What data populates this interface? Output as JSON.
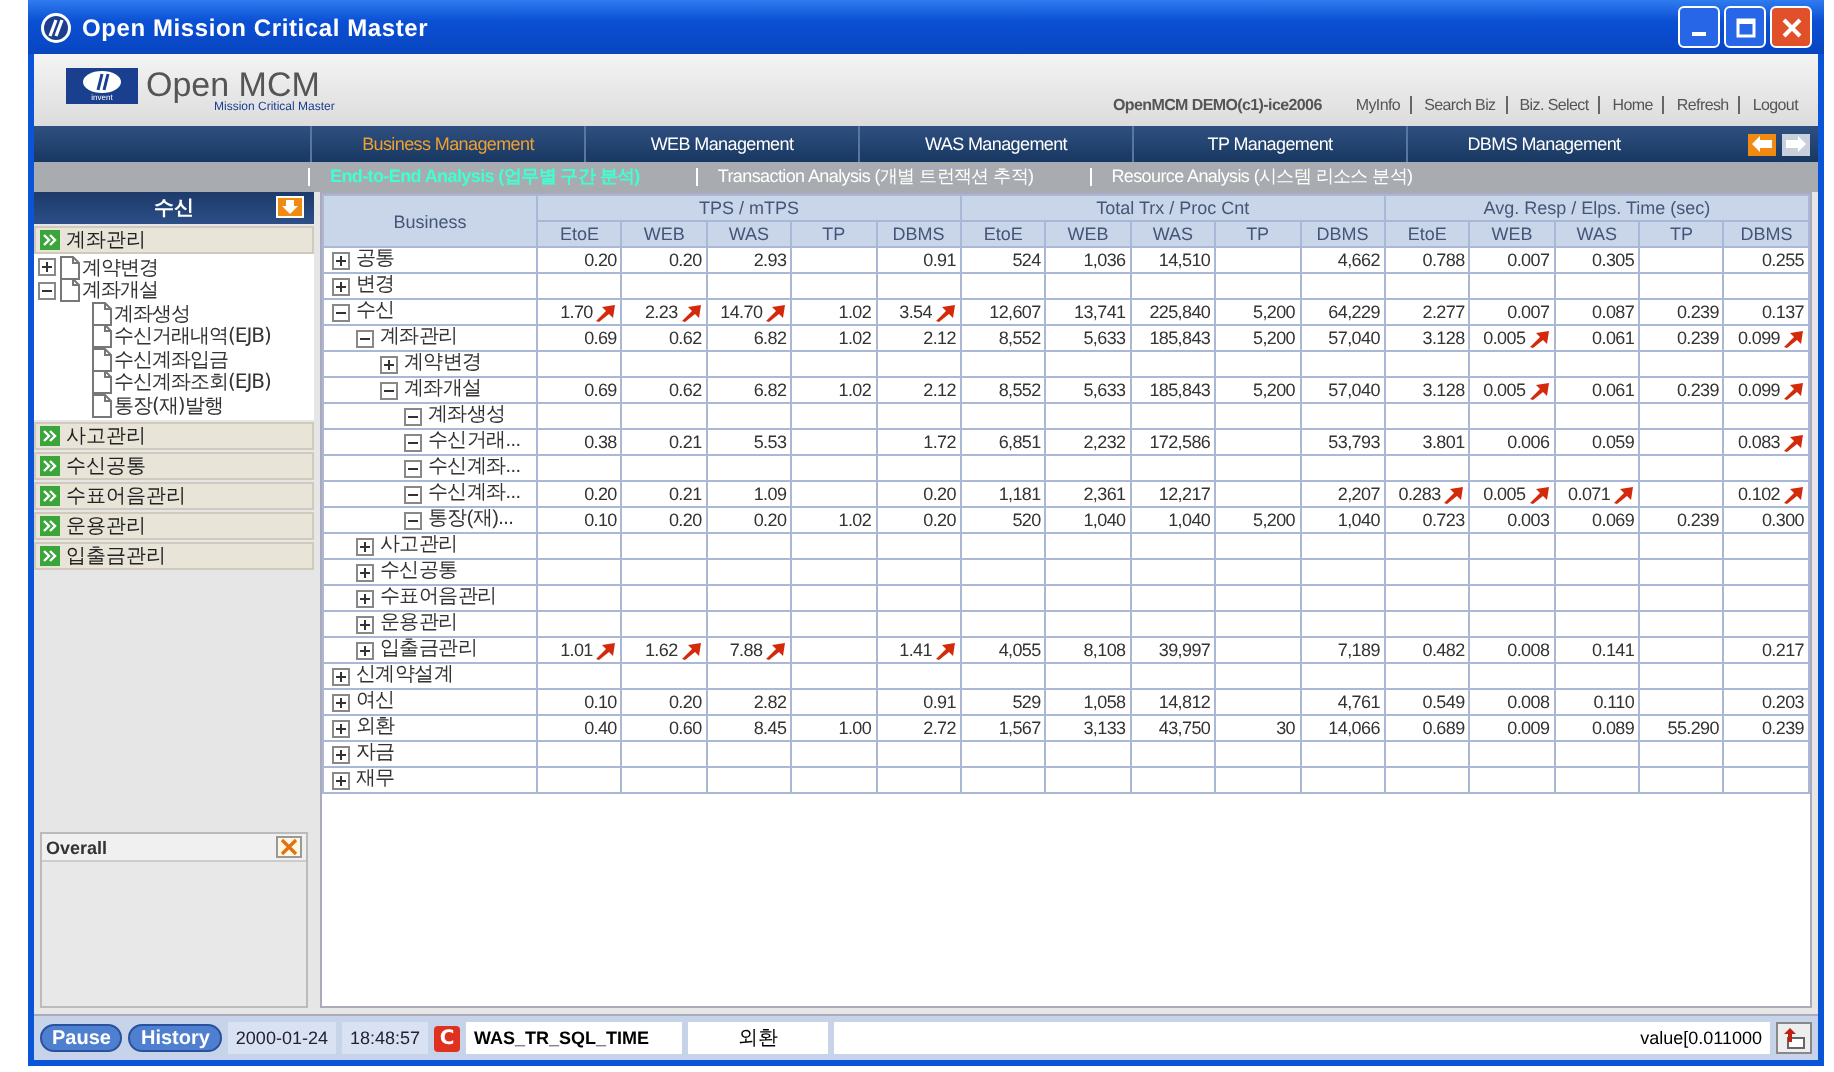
{
  "window": {
    "title": "Open Mission Critical Master"
  },
  "logo": {
    "brand": "Open MCM",
    "tagline": "Mission Critical Master",
    "badge": "invent"
  },
  "header": {
    "user": "OpenMCM DEMO(c1)-ice2006",
    "links": [
      "MyInfo",
      "Search Biz",
      "Biz. Select",
      "Home",
      "Refresh",
      "Logout"
    ]
  },
  "nav_tabs": [
    {
      "label": "Business Management",
      "selected": true
    },
    {
      "label": "WEB Management",
      "selected": false
    },
    {
      "label": "WAS Management",
      "selected": false
    },
    {
      "label": "TP Management",
      "selected": false
    },
    {
      "label": "DBMS Management",
      "selected": false
    }
  ],
  "sub_tabs": [
    {
      "label": "End-to-End Analysis (업무별 구간 분석)",
      "selected": true
    },
    {
      "label": "Transaction Analysis (개별 트런잭션 추적)",
      "selected": false
    },
    {
      "label": "Resource Analysis (시스템 리소스 분석)",
      "selected": false
    }
  ],
  "sidebar": {
    "title": "수신",
    "sections": [
      {
        "label": "계좌관리",
        "expanded": true,
        "children": [
          {
            "label": "계약변경",
            "expanded": false
          },
          {
            "label": "계좌개설",
            "expanded": true,
            "children": [
              {
                "label": "계좌생성"
              },
              {
                "label": "수신거래내역(EJB)"
              },
              {
                "label": "수신계좌입금"
              },
              {
                "label": "수신계좌조회(EJB)"
              },
              {
                "label": "통장(재)발행"
              }
            ]
          }
        ]
      },
      {
        "label": "사고관리",
        "expanded": false
      },
      {
        "label": "수신공통",
        "expanded": false
      },
      {
        "label": "수표어음관리",
        "expanded": false
      },
      {
        "label": "운용관리",
        "expanded": false
      },
      {
        "label": "입출금관리",
        "expanded": false
      }
    ]
  },
  "overall": {
    "title": "Overall"
  },
  "table": {
    "business_header": "Business",
    "groups": [
      {
        "label": "TPS / mTPS",
        "columns": [
          "EtoE",
          "WEB",
          "WAS",
          "TP",
          "DBMS"
        ]
      },
      {
        "label": "Total Trx / Proc Cnt",
        "columns": [
          "EtoE",
          "WEB",
          "WAS",
          "TP",
          "DBMS"
        ]
      },
      {
        "label": "Avg. Resp / Elps. Time (sec)",
        "columns": [
          "EtoE",
          "WEB",
          "WAS",
          "TP",
          "DBMS"
        ]
      }
    ],
    "rows": [
      {
        "name": "공통",
        "expanded": false,
        "tps": {
          "etoe": {
            "text": "0.20",
            "alert": false
          },
          "web": {
            "text": "0.20",
            "alert": false
          },
          "was": {
            "text": "2.93",
            "alert": false
          },
          "dbms": {
            "text": "0.91",
            "alert": false
          }
        },
        "trx": {
          "etoe": {
            "text": "524",
            "alert": false
          },
          "web": {
            "text": "1,036",
            "alert": false
          },
          "was": {
            "text": "14,510",
            "alert": false
          },
          "dbms": {
            "text": "4,662",
            "alert": false
          }
        },
        "resp": {
          "etoe": {
            "text": "0.788",
            "alert": false
          },
          "web": {
            "text": "0.007",
            "alert": false
          },
          "was": {
            "text": "0.305",
            "alert": false
          },
          "dbms": {
            "text": "0.255",
            "alert": false
          }
        }
      },
      {
        "name": "변경",
        "expanded": false
      },
      {
        "name": "수신",
        "expanded": true,
        "tps": {
          "etoe": {
            "text": "1.70",
            "alert": true
          },
          "web": {
            "text": "2.23",
            "alert": true
          },
          "was": {
            "text": "14.70",
            "alert": true
          },
          "tp": {
            "text": "1.02",
            "alert": false
          },
          "dbms": {
            "text": "3.54",
            "alert": true
          }
        },
        "trx": {
          "etoe": {
            "text": "12,607",
            "alert": false
          },
          "web": {
            "text": "13,741",
            "alert": false
          },
          "was": {
            "text": "225,840",
            "alert": false
          },
          "tp": {
            "text": "5,200",
            "alert": false
          },
          "dbms": {
            "text": "64,229",
            "alert": false
          }
        },
        "resp": {
          "etoe": {
            "text": "2.277",
            "alert": false
          },
          "web": {
            "text": "0.007",
            "alert": false
          },
          "was": {
            "text": "0.087",
            "alert": false
          },
          "tp": {
            "text": "0.239",
            "alert": false
          },
          "dbms": {
            "text": "0.137",
            "alert": false
          }
        },
        "children": [
          {
            "name": "계좌관리",
            "expanded": true,
            "tps": {
              "etoe": {
                "text": "0.69",
                "alert": false
              },
              "web": {
                "text": "0.62",
                "alert": false
              },
              "was": {
                "text": "6.82",
                "alert": false
              },
              "tp": {
                "text": "1.02",
                "alert": false
              },
              "dbms": {
                "text": "2.12",
                "alert": false
              }
            },
            "trx": {
              "etoe": {
                "text": "8,552",
                "alert": false
              },
              "web": {
                "text": "5,633",
                "alert": false
              },
              "was": {
                "text": "185,843",
                "alert": false
              },
              "tp": {
                "text": "5,200",
                "alert": false
              },
              "dbms": {
                "text": "57,040",
                "alert": false
              }
            },
            "resp": {
              "etoe": {
                "text": "3.128",
                "alert": false
              },
              "web": {
                "text": "0.005",
                "alert": true
              },
              "was": {
                "text": "0.061",
                "alert": false
              },
              "tp": {
                "text": "0.239",
                "alert": false
              },
              "dbms": {
                "text": "0.099",
                "alert": true
              }
            },
            "children": [
              {
                "name": "계약변경",
                "expanded": false
              },
              {
                "name": "계좌개설",
                "expanded": true,
                "tps": {
                  "etoe": {
                    "text": "0.69",
                    "alert": false
                  },
                  "web": {
                    "text": "0.62",
                    "alert": false
                  },
                  "was": {
                    "text": "6.82",
                    "alert": false
                  },
                  "tp": {
                    "text": "1.02",
                    "alert": false
                  },
                  "dbms": {
                    "text": "2.12",
                    "alert": false
                  }
                },
                "trx": {
                  "etoe": {
                    "text": "8,552",
                    "alert": false
                  },
                  "web": {
                    "text": "5,633",
                    "alert": false
                  },
                  "was": {
                    "text": "185,843",
                    "alert": false
                  },
                  "tp": {
                    "text": "5,200",
                    "alert": false
                  },
                  "dbms": {
                    "text": "57,040",
                    "alert": false
                  }
                },
                "resp": {
                  "etoe": {
                    "text": "3.128",
                    "alert": false
                  },
                  "web": {
                    "text": "0.005",
                    "alert": true
                  },
                  "was": {
                    "text": "0.061",
                    "alert": false
                  },
                  "tp": {
                    "text": "0.239",
                    "alert": false
                  },
                  "dbms": {
                    "text": "0.099",
                    "alert": true
                  }
                },
                "children": [
                  {
                    "name": "계좌생성",
                    "expanded": true
                  },
                  {
                    "name": "수신거래...",
                    "expanded": true,
                    "tps": {
                      "etoe": {
                        "text": "0.38",
                        "alert": false
                      },
                      "web": {
                        "text": "0.21",
                        "alert": false
                      },
                      "was": {
                        "text": "5.53",
                        "alert": false
                      },
                      "dbms": {
                        "text": "1.72",
                        "alert": false
                      }
                    },
                    "trx": {
                      "etoe": {
                        "text": "6,851",
                        "alert": false
                      },
                      "web": {
                        "text": "2,232",
                        "alert": false
                      },
                      "was": {
                        "text": "172,586",
                        "alert": false
                      },
                      "dbms": {
                        "text": "53,793",
                        "alert": false
                      }
                    },
                    "resp": {
                      "etoe": {
                        "text": "3.801",
                        "alert": false
                      },
                      "web": {
                        "text": "0.006",
                        "alert": false
                      },
                      "was": {
                        "text": "0.059",
                        "alert": false
                      },
                      "dbms": {
                        "text": "0.083",
                        "alert": true
                      }
                    }
                  },
                  {
                    "name": "수신계좌...",
                    "expanded": true
                  },
                  {
                    "name": "수신계좌...",
                    "expanded": true,
                    "tps": {
                      "etoe": {
                        "text": "0.20",
                        "alert": false
                      },
                      "web": {
                        "text": "0.21",
                        "alert": false
                      },
                      "was": {
                        "text": "1.09",
                        "alert": false
                      },
                      "dbms": {
                        "text": "0.20",
                        "alert": false
                      }
                    },
                    "trx": {
                      "etoe": {
                        "text": "1,181",
                        "alert": false
                      },
                      "web": {
                        "text": "2,361",
                        "alert": false
                      },
                      "was": {
                        "text": "12,217",
                        "alert": false
                      },
                      "dbms": {
                        "text": "2,207",
                        "alert": false
                      }
                    },
                    "resp": {
                      "etoe": {
                        "text": "0.283",
                        "alert": true
                      },
                      "web": {
                        "text": "0.005",
                        "alert": true
                      },
                      "was": {
                        "text": "0.071",
                        "alert": true
                      },
                      "dbms": {
                        "text": "0.102",
                        "alert": true
                      }
                    }
                  },
                  {
                    "name": "통장(재)...",
                    "expanded": true,
                    "tps": {
                      "etoe": {
                        "text": "0.10",
                        "alert": false
                      },
                      "web": {
                        "text": "0.20",
                        "alert": false
                      },
                      "was": {
                        "text": "0.20",
                        "alert": false
                      },
                      "tp": {
                        "text": "1.02",
                        "alert": false
                      },
                      "dbms": {
                        "text": "0.20",
                        "alert": false
                      }
                    },
                    "trx": {
                      "etoe": {
                        "text": "520",
                        "alert": false
                      },
                      "web": {
                        "text": "1,040",
                        "alert": false
                      },
                      "was": {
                        "text": "1,040",
                        "alert": false
                      },
                      "tp": {
                        "text": "5,200",
                        "alert": false
                      },
                      "dbms": {
                        "text": "1,040",
                        "alert": false
                      }
                    },
                    "resp": {
                      "etoe": {
                        "text": "0.723",
                        "alert": false
                      },
                      "web": {
                        "text": "0.003",
                        "alert": false
                      },
                      "was": {
                        "text": "0.069",
                        "alert": false
                      },
                      "tp": {
                        "text": "0.239",
                        "alert": false
                      },
                      "dbms": {
                        "text": "0.300",
                        "alert": false
                      }
                    }
                  }
                ]
              }
            ]
          },
          {
            "name": "사고관리",
            "expanded": false
          },
          {
            "name": "수신공통",
            "expanded": false
          },
          {
            "name": "수표어음관리",
            "expanded": false
          },
          {
            "name": "운용관리",
            "expanded": false
          },
          {
            "name": "입출금관리",
            "expanded": false,
            "tps": {
              "etoe": {
                "text": "1.01",
                "alert": true
              },
              "web": {
                "text": "1.62",
                "alert": true
              },
              "was": {
                "text": "7.88",
                "alert": true
              },
              "dbms": {
                "text": "1.41",
                "alert": true
              }
            },
            "trx": {
              "etoe": {
                "text": "4,055",
                "alert": false
              },
              "web": {
                "text": "8,108",
                "alert": false
              },
              "was": {
                "text": "39,997",
                "alert": false
              },
              "dbms": {
                "text": "7,189",
                "alert": false
              }
            },
            "resp": {
              "etoe": {
                "text": "0.482",
                "alert": false
              },
              "web": {
                "text": "0.008",
                "alert": false
              },
              "was": {
                "text": "0.141",
                "alert": false
              },
              "dbms": {
                "text": "0.217",
                "alert": false
              }
            }
          }
        ]
      },
      {
        "name": "신계약설계",
        "expanded": false
      },
      {
        "name": "여신",
        "expanded": false,
        "tps": {
          "etoe": {
            "text": "0.10",
            "alert": false
          },
          "web": {
            "text": "0.20",
            "alert": false
          },
          "was": {
            "text": "2.82",
            "alert": false
          },
          "dbms": {
            "text": "0.91",
            "alert": false
          }
        },
        "trx": {
          "etoe": {
            "text": "529",
            "alert": false
          },
          "web": {
            "text": "1,058",
            "alert": false
          },
          "was": {
            "text": "14,812",
            "alert": false
          },
          "dbms": {
            "text": "4,761",
            "alert": false
          }
        },
        "resp": {
          "etoe": {
            "text": "0.549",
            "alert": false
          },
          "web": {
            "text": "0.008",
            "alert": false
          },
          "was": {
            "text": "0.110",
            "alert": false
          },
          "dbms": {
            "text": "0.203",
            "alert": false
          }
        }
      },
      {
        "name": "외환",
        "expanded": false,
        "tps": {
          "etoe": {
            "text": "0.40",
            "alert": false
          },
          "web": {
            "text": "0.60",
            "alert": false
          },
          "was": {
            "text": "8.45",
            "alert": false
          },
          "tp": {
            "text": "1.00",
            "alert": false
          },
          "dbms": {
            "text": "2.72",
            "alert": false
          }
        },
        "trx": {
          "etoe": {
            "text": "1,567",
            "alert": false
          },
          "web": {
            "text": "3,133",
            "alert": false
          },
          "was": {
            "text": "43,750",
            "alert": false
          },
          "tp": {
            "text": "30",
            "alert": false
          },
          "dbms": {
            "text": "14,066",
            "alert": false
          }
        },
        "resp": {
          "etoe": {
            "text": "0.689",
            "alert": false
          },
          "web": {
            "text": "0.009",
            "alert": false
          },
          "was": {
            "text": "0.089",
            "alert": false
          },
          "tp": {
            "text": "55.290",
            "alert": false
          },
          "dbms": {
            "text": "0.239",
            "alert": false
          }
        }
      },
      {
        "name": "자금",
        "expanded": false
      },
      {
        "name": "재무",
        "expanded": false
      }
    ]
  },
  "status_bar": {
    "buttons": [
      "Pause",
      "History"
    ],
    "date": "2000-01-24",
    "time": "18:48:57",
    "flag": "C",
    "metric": "WAS_TR_SQL_TIME",
    "business": "외환",
    "value": "value[0.011000"
  }
}
